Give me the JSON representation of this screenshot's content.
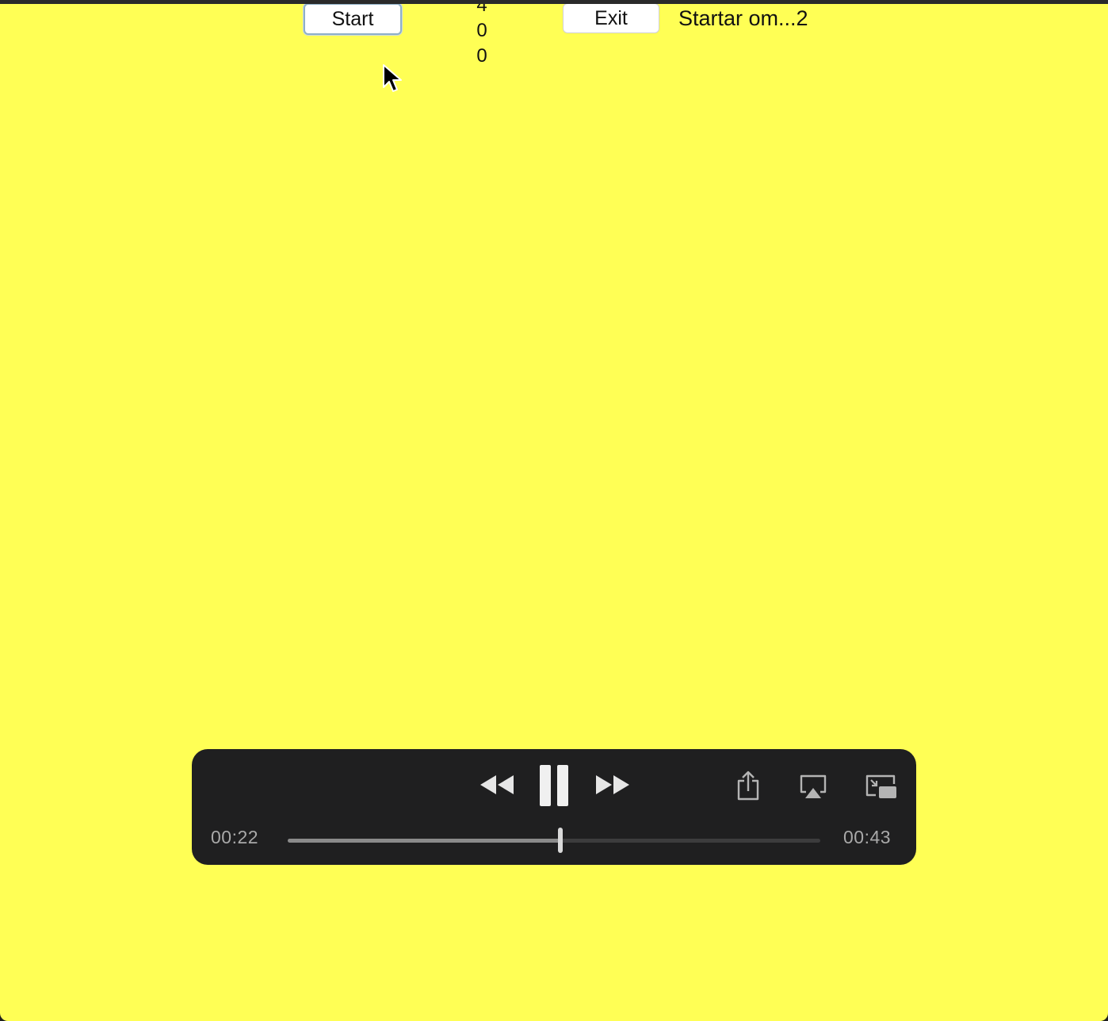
{
  "app": {
    "start_label": "Start",
    "exit_label": "Exit",
    "counter_lines": [
      "4",
      "0",
      "0"
    ],
    "status_text": "Startar om...2",
    "background_color": "#ffff55"
  },
  "player": {
    "elapsed": "00:22",
    "total": "00:43",
    "progress": 0.512,
    "icons": [
      "rewind-icon",
      "pause-icon",
      "fast-forward-icon",
      "share-icon",
      "airplay-icon",
      "picture-in-picture-icon"
    ]
  }
}
